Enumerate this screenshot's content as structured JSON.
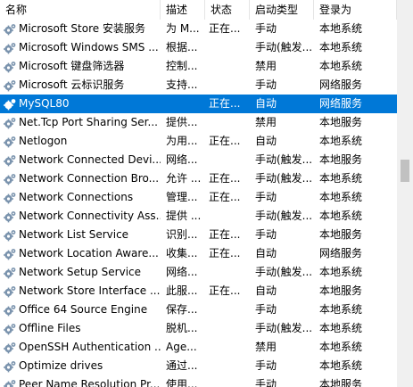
{
  "columns": {
    "name": "名称",
    "desc": "描述",
    "status": "状态",
    "startup": "启动类型",
    "logon": "登录为"
  },
  "colors": {
    "selected_bg": "#0078d7",
    "gear": "#7a93ad",
    "scrollbar_track": "#f0f0f0",
    "scrollbar_thumb": "#c1c1c1"
  },
  "icon": "gear-icon",
  "rows": [
    {
      "name": "Microsoft Store 安装服务",
      "desc": "为 M...",
      "status": "正在...",
      "startup": "手动",
      "logon": "本地系统"
    },
    {
      "name": "Microsoft Windows SMS ...",
      "desc": "根据...",
      "status": "",
      "startup": "手动(触发...",
      "logon": "本地系统"
    },
    {
      "name": "Microsoft 键盘筛选器",
      "desc": "控制...",
      "status": "",
      "startup": "禁用",
      "logon": "本地系统"
    },
    {
      "name": "Microsoft 云标识服务",
      "desc": "支持...",
      "status": "",
      "startup": "手动",
      "logon": "网络服务"
    },
    {
      "name": "MySQL80",
      "desc": "",
      "status": "正在...",
      "startup": "自动",
      "logon": "网络服务",
      "selected": true
    },
    {
      "name": "Net.Tcp Port Sharing Ser...",
      "desc": "提供...",
      "status": "",
      "startup": "禁用",
      "logon": "本地服务"
    },
    {
      "name": "Netlogon",
      "desc": "为用...",
      "status": "正在...",
      "startup": "自动",
      "logon": "本地系统"
    },
    {
      "name": "Network Connected Devi...",
      "desc": "网络...",
      "status": "",
      "startup": "手动(触发...",
      "logon": "本地服务"
    },
    {
      "name": "Network Connection Bro...",
      "desc": "允许 ...",
      "status": "正在...",
      "startup": "手动(触发...",
      "logon": "本地系统"
    },
    {
      "name": "Network Connections",
      "desc": "管理...",
      "status": "正在...",
      "startup": "手动",
      "logon": "本地系统"
    },
    {
      "name": "Network Connectivity Ass...",
      "desc": "提供 ...",
      "status": "",
      "startup": "手动(触发...",
      "logon": "本地系统"
    },
    {
      "name": "Network List Service",
      "desc": "识别...",
      "status": "正在...",
      "startup": "手动",
      "logon": "本地服务"
    },
    {
      "name": "Network Location Aware...",
      "desc": "收集...",
      "status": "正在...",
      "startup": "自动",
      "logon": "网络服务"
    },
    {
      "name": "Network Setup Service",
      "desc": "网络...",
      "status": "",
      "startup": "手动(触发...",
      "logon": "本地系统"
    },
    {
      "name": "Network Store Interface ...",
      "desc": "此服...",
      "status": "正在...",
      "startup": "自动",
      "logon": "本地服务"
    },
    {
      "name": "Office 64 Source Engine",
      "desc": "保存...",
      "status": "",
      "startup": "手动",
      "logon": "本地系统"
    },
    {
      "name": "Offline Files",
      "desc": "脱机...",
      "status": "",
      "startup": "手动(触发...",
      "logon": "本地系统"
    },
    {
      "name": "OpenSSH Authentication ...",
      "desc": "Age...",
      "status": "",
      "startup": "禁用",
      "logon": "本地系统"
    },
    {
      "name": "Optimize drives",
      "desc": "通过...",
      "status": "",
      "startup": "手动",
      "logon": "本地系统"
    },
    {
      "name": "Peer Name Resolution Pr...",
      "desc": "使用...",
      "status": "",
      "startup": "手动",
      "logon": "本地服务"
    }
  ]
}
